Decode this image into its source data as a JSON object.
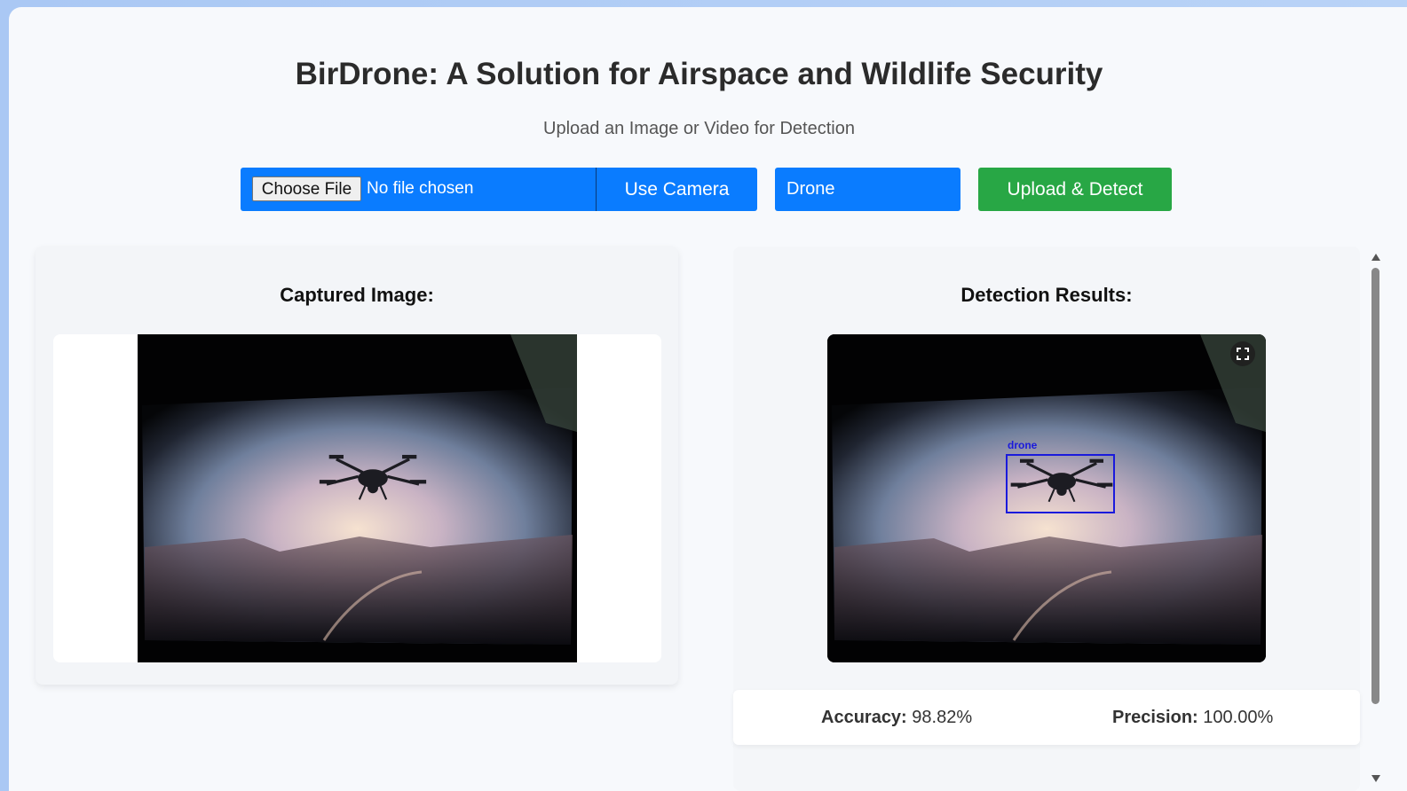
{
  "header": {
    "title": "BirDrone: A Solution for Airspace and Wildlife Security",
    "subtitle": "Upload an Image or Video for Detection"
  },
  "controls": {
    "choose_file_label": "Choose File",
    "file_status": "No file chosen",
    "camera_label": "Use Camera",
    "mode_selected": "Drone",
    "upload_label": "Upload & Detect"
  },
  "captured": {
    "heading": "Captured Image:"
  },
  "results": {
    "heading": "Detection Results:",
    "detection_label": "drone",
    "accuracy_label": "Accuracy:",
    "accuracy_value": "98.82%",
    "precision_label": "Precision:",
    "precision_value": "100.00%"
  },
  "colors": {
    "primary": "#0a7cff",
    "success": "#28a745",
    "bbox": "#1a1adc"
  },
  "icons": {
    "expand": "fullscreen-icon"
  }
}
